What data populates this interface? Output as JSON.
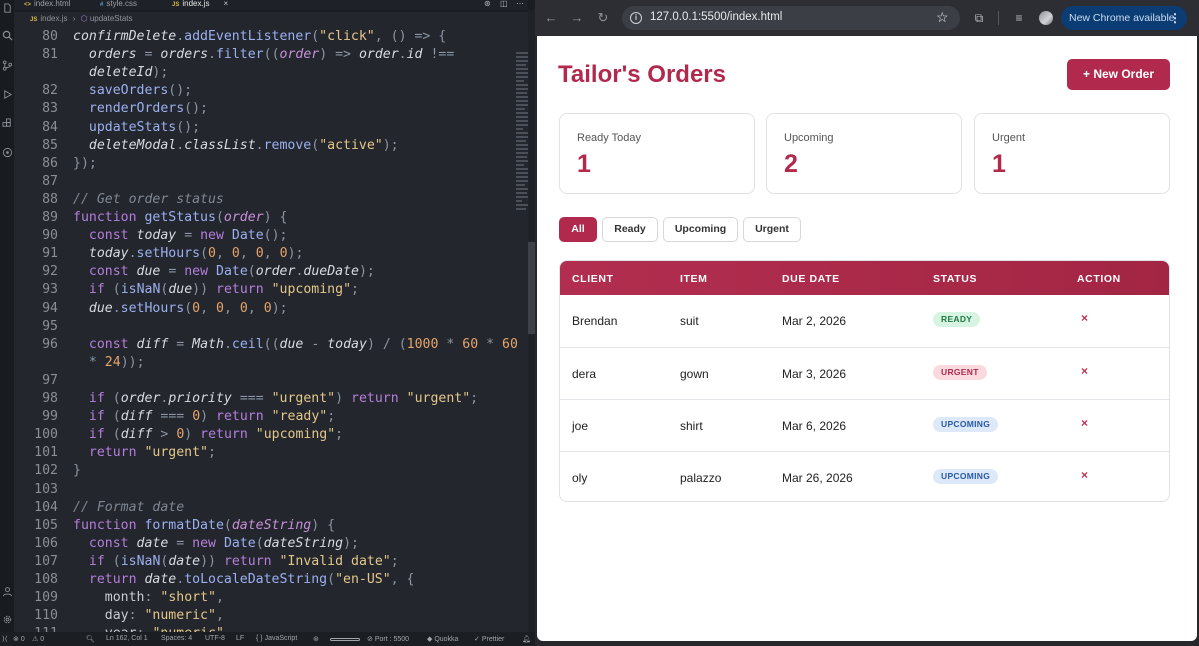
{
  "editor": {
    "tabs": [
      {
        "name": "index.html",
        "type": "html"
      },
      {
        "name": "style.css",
        "type": "css"
      },
      {
        "name": "index.js",
        "type": "js",
        "active": true
      }
    ],
    "breadcrumb": {
      "file": "index.js",
      "symbol": "updateStats"
    },
    "lines": [
      {
        "n": "80",
        "html": "<span class=\"v\">confirmDelete</span><span class=\"o\">.</span><span class=\"f\">addEventListener</span><span class=\"o\">(</span><span class=\"s\">\"click\"</span><span class=\"o\">, () =&gt; {</span>"
      },
      {
        "n": "81",
        "html": "  <span class=\"v\">orders</span> <span class=\"o\">=</span> <span class=\"v\">orders</span><span class=\"o\">.</span><span class=\"f\">filter</span><span class=\"o\">((</span><span class=\"p\">order</span><span class=\"o\">) =&gt;</span> <span class=\"v\">order</span><span class=\"o\">.</span><span class=\"v\">id</span> <span class=\"o\">!==</span>"
      },
      {
        "n": "",
        "html": "  <span class=\"v\">deleteId</span><span class=\"o\">);</span>"
      },
      {
        "n": "82",
        "html": "  <span class=\"f\">saveOrders</span><span class=\"o\">();</span>"
      },
      {
        "n": "83",
        "html": "  <span class=\"f\">renderOrders</span><span class=\"o\">();</span>"
      },
      {
        "n": "84",
        "html": "  <span class=\"f\">updateStats</span><span class=\"o\">();</span>"
      },
      {
        "n": "85",
        "html": "  <span class=\"v\">deleteModal</span><span class=\"o\">.</span><span class=\"v\">classList</span><span class=\"o\">.</span><span class=\"f\">remove</span><span class=\"o\">(</span><span class=\"s\">\"active\"</span><span class=\"o\">);</span>"
      },
      {
        "n": "86",
        "html": "<span class=\"o\">});</span>"
      },
      {
        "n": "87",
        "html": ""
      },
      {
        "n": "88",
        "html": "<span class=\"c\">// Get order status</span>"
      },
      {
        "n": "89",
        "html": "<span class=\"k\">function</span> <span class=\"f\">getStatus</span><span class=\"o\">(</span><span class=\"p\">order</span><span class=\"o\">) {</span>"
      },
      {
        "n": "90",
        "html": "  <span class=\"k\">const</span> <span class=\"v\">today</span> <span class=\"o\">=</span> <span class=\"k\">new</span> <span class=\"f\">Date</span><span class=\"o\">();</span>"
      },
      {
        "n": "91",
        "html": "  <span class=\"v\">today</span><span class=\"o\">.</span><span class=\"f\">setHours</span><span class=\"o\">(</span><span class=\"n\">0</span><span class=\"o\">,</span> <span class=\"n\">0</span><span class=\"o\">,</span> <span class=\"n\">0</span><span class=\"o\">,</span> <span class=\"n\">0</span><span class=\"o\">);</span>"
      },
      {
        "n": "92",
        "html": "  <span class=\"k\">const</span> <span class=\"v\">due</span> <span class=\"o\">=</span> <span class=\"k\">new</span> <span class=\"f\">Date</span><span class=\"o\">(</span><span class=\"v\">order</span><span class=\"o\">.</span><span class=\"v\">dueDate</span><span class=\"o\">);</span>"
      },
      {
        "n": "93",
        "html": "  <span class=\"k\">if</span> <span class=\"o\">(</span><span class=\"f\">isNaN</span><span class=\"o\">(</span><span class=\"v\">due</span><span class=\"o\">))</span> <span class=\"k\">return</span> <span class=\"s\">\"upcoming\"</span><span class=\"o\">;</span>"
      },
      {
        "n": "94",
        "html": "  <span class=\"v\">due</span><span class=\"o\">.</span><span class=\"f\">setHours</span><span class=\"o\">(</span><span class=\"n\">0</span><span class=\"o\">,</span> <span class=\"n\">0</span><span class=\"o\">,</span> <span class=\"n\">0</span><span class=\"o\">,</span> <span class=\"n\">0</span><span class=\"o\">);</span>"
      },
      {
        "n": "95",
        "html": ""
      },
      {
        "n": "96",
        "html": "  <span class=\"k\">const</span> <span class=\"v\">diff</span> <span class=\"o\">=</span> <span class=\"v\">Math</span><span class=\"o\">.</span><span class=\"f\">ceil</span><span class=\"o\">((</span><span class=\"v\">due</span> <span class=\"o\">-</span> <span class=\"v\">today</span><span class=\"o\">) / (</span><span class=\"n\">1000</span> <span class=\"o\">*</span> <span class=\"n\">60</span> <span class=\"o\">*</span> <span class=\"n\">60</span>"
      },
      {
        "n": "",
        "html": "  <span class=\"o\">*</span> <span class=\"n\">24</span><span class=\"o\">));</span>"
      },
      {
        "n": "97",
        "html": ""
      },
      {
        "n": "98",
        "html": "  <span class=\"k\">if</span> <span class=\"o\">(</span><span class=\"v\">order</span><span class=\"o\">.</span><span class=\"v\">priority</span> <span class=\"o\">===</span> <span class=\"s\">\"urgent\"</span><span class=\"o\">)</span> <span class=\"k\">return</span> <span class=\"s\">\"urgent\"</span><span class=\"o\">;</span>"
      },
      {
        "n": "99",
        "html": "  <span class=\"k\">if</span> <span class=\"o\">(</span><span class=\"v\">diff</span> <span class=\"o\">===</span> <span class=\"n\">0</span><span class=\"o\">)</span> <span class=\"k\">return</span> <span class=\"s\">\"ready\"</span><span class=\"o\">;</span>"
      },
      {
        "n": "100",
        "html": "  <span class=\"k\">if</span> <span class=\"o\">(</span><span class=\"v\">diff</span> <span class=\"o\">&gt;</span> <span class=\"n\">0</span><span class=\"o\">)</span> <span class=\"k\">return</span> <span class=\"s\">\"upcoming\"</span><span class=\"o\">;</span>"
      },
      {
        "n": "101",
        "html": "  <span class=\"k\">return</span> <span class=\"s\">\"urgent\"</span><span class=\"o\">;</span>"
      },
      {
        "n": "102",
        "html": "<span class=\"o\">}</span>"
      },
      {
        "n": "103",
        "html": ""
      },
      {
        "n": "104",
        "html": "<span class=\"c\">// Format date</span>"
      },
      {
        "n": "105",
        "html": "<span class=\"k\">function</span> <span class=\"f\">formatDate</span><span class=\"o\">(</span><span class=\"p\">dateString</span><span class=\"o\">) {</span>"
      },
      {
        "n": "106",
        "html": "  <span class=\"k\">const</span> <span class=\"v\">date</span> <span class=\"o\">=</span> <span class=\"k\">new</span> <span class=\"f\">Date</span><span class=\"o\">(</span><span class=\"v\">dateString</span><span class=\"o\">);</span>"
      },
      {
        "n": "107",
        "html": "  <span class=\"k\">if</span> <span class=\"o\">(</span><span class=\"f\">isNaN</span><span class=\"o\">(</span><span class=\"v\">date</span><span class=\"o\">))</span> <span class=\"k\">return</span> <span class=\"s\">\"Invalid date\"</span><span class=\"o\">;</span>"
      },
      {
        "n": "108",
        "html": "  <span class=\"k\">return</span> <span class=\"v\">date</span><span class=\"o\">.</span><span class=\"f\">toLocaleDateString</span><span class=\"o\">(</span><span class=\"s\">\"en-US\"</span><span class=\"o\">, {</span>"
      },
      {
        "n": "109",
        "html": "    month<span class=\"o\">:</span> <span class=\"s\">\"short\"</span><span class=\"o\">,</span>"
      },
      {
        "n": "110",
        "html": "    day<span class=\"o\">:</span> <span class=\"s\">\"numeric\"</span><span class=\"o\">,</span>"
      },
      {
        "n": "111",
        "html": "    year<span class=\"o\">:</span> <span class=\"s\">\"numeric\"</span>"
      }
    ],
    "status": {
      "errors": "0",
      "warnings": "0",
      "position": "Ln 162, Col 1",
      "spaces": "Spaces: 4",
      "encoding": "UTF-8",
      "eol": "LF",
      "language": "JavaScript",
      "port": "Port : 5500",
      "quokka": "Quokka",
      "prettier": "Prettier"
    }
  },
  "browser": {
    "url": "127.0.0.1:5500/index.html",
    "update_label": "New Chrome available",
    "page": {
      "title": "Tailor's Orders",
      "new_order_label": "+ New Order",
      "stats": [
        {
          "label": "Ready Today",
          "value": "1"
        },
        {
          "label": "Upcoming",
          "value": "2"
        },
        {
          "label": "Urgent",
          "value": "1"
        }
      ],
      "filters": [
        "All",
        "Ready",
        "Upcoming",
        "Urgent"
      ],
      "active_filter": "All",
      "columns": [
        "CLIENT",
        "ITEM",
        "DUE DATE",
        "STATUS",
        "ACTION"
      ],
      "orders": [
        {
          "client": "Brendan",
          "item": "suit",
          "due": "Mar 2, 2026",
          "status": "READY",
          "status_kind": "ready",
          "action": "×"
        },
        {
          "client": "dera",
          "item": "gown",
          "due": "Mar 3, 2026",
          "status": "URGENT",
          "status_kind": "urgent",
          "action": "×"
        },
        {
          "client": "joe",
          "item": "shirt",
          "due": "Mar 6, 2026",
          "status": "UPCOMING",
          "status_kind": "upcoming",
          "action": "×"
        },
        {
          "client": "oly",
          "item": "palazzo",
          "due": "Mar 26, 2026",
          "status": "UPCOMING",
          "status_kind": "upcoming",
          "action": "×"
        }
      ],
      "accent_color": "#b12a4d"
    }
  }
}
